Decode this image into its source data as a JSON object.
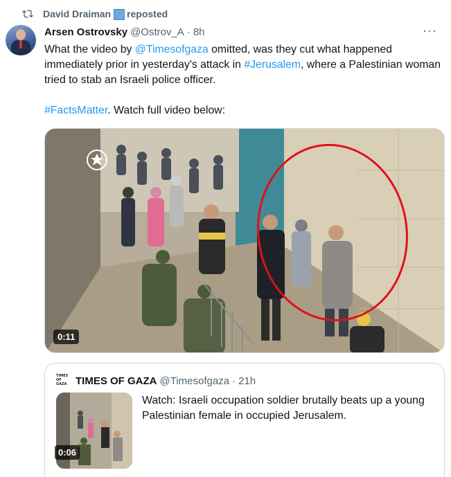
{
  "repost": {
    "user": "David Draiman",
    "label": "reposted"
  },
  "tweet": {
    "author_name": "Arsen Ostrovsky",
    "author_handle": "@Ostrov_A",
    "separator": "·",
    "time": "8h",
    "more": "···",
    "text": {
      "p1_a": "What the video by ",
      "p1_link1": "@Timesofgaza",
      "p1_b": " omitted, was they cut what happened immediately prior in yesterday's attack in ",
      "p1_link2": "#Jerusalem",
      "p1_c": ", where a Palestinian woman tried to stab an Israeli police officer.",
      "p2_link": "#FactsMatter",
      "p2_b": ". Watch full video below:"
    },
    "video_duration": "0:11"
  },
  "quote": {
    "avatar_text": "TIMES OF GAZA",
    "name": "TIMES OF GAZA",
    "handle": "@Timesofgaza",
    "separator": "·",
    "time": "21h",
    "text": "Watch: Israeli occupation soldier brutally beats up a young Palestinian female in occupied Jerusalem.",
    "video_duration": "0:06"
  },
  "colors": {
    "link": "#1d9bf0",
    "secondary_text": "#536471",
    "circle_highlight": "#e0101a"
  }
}
